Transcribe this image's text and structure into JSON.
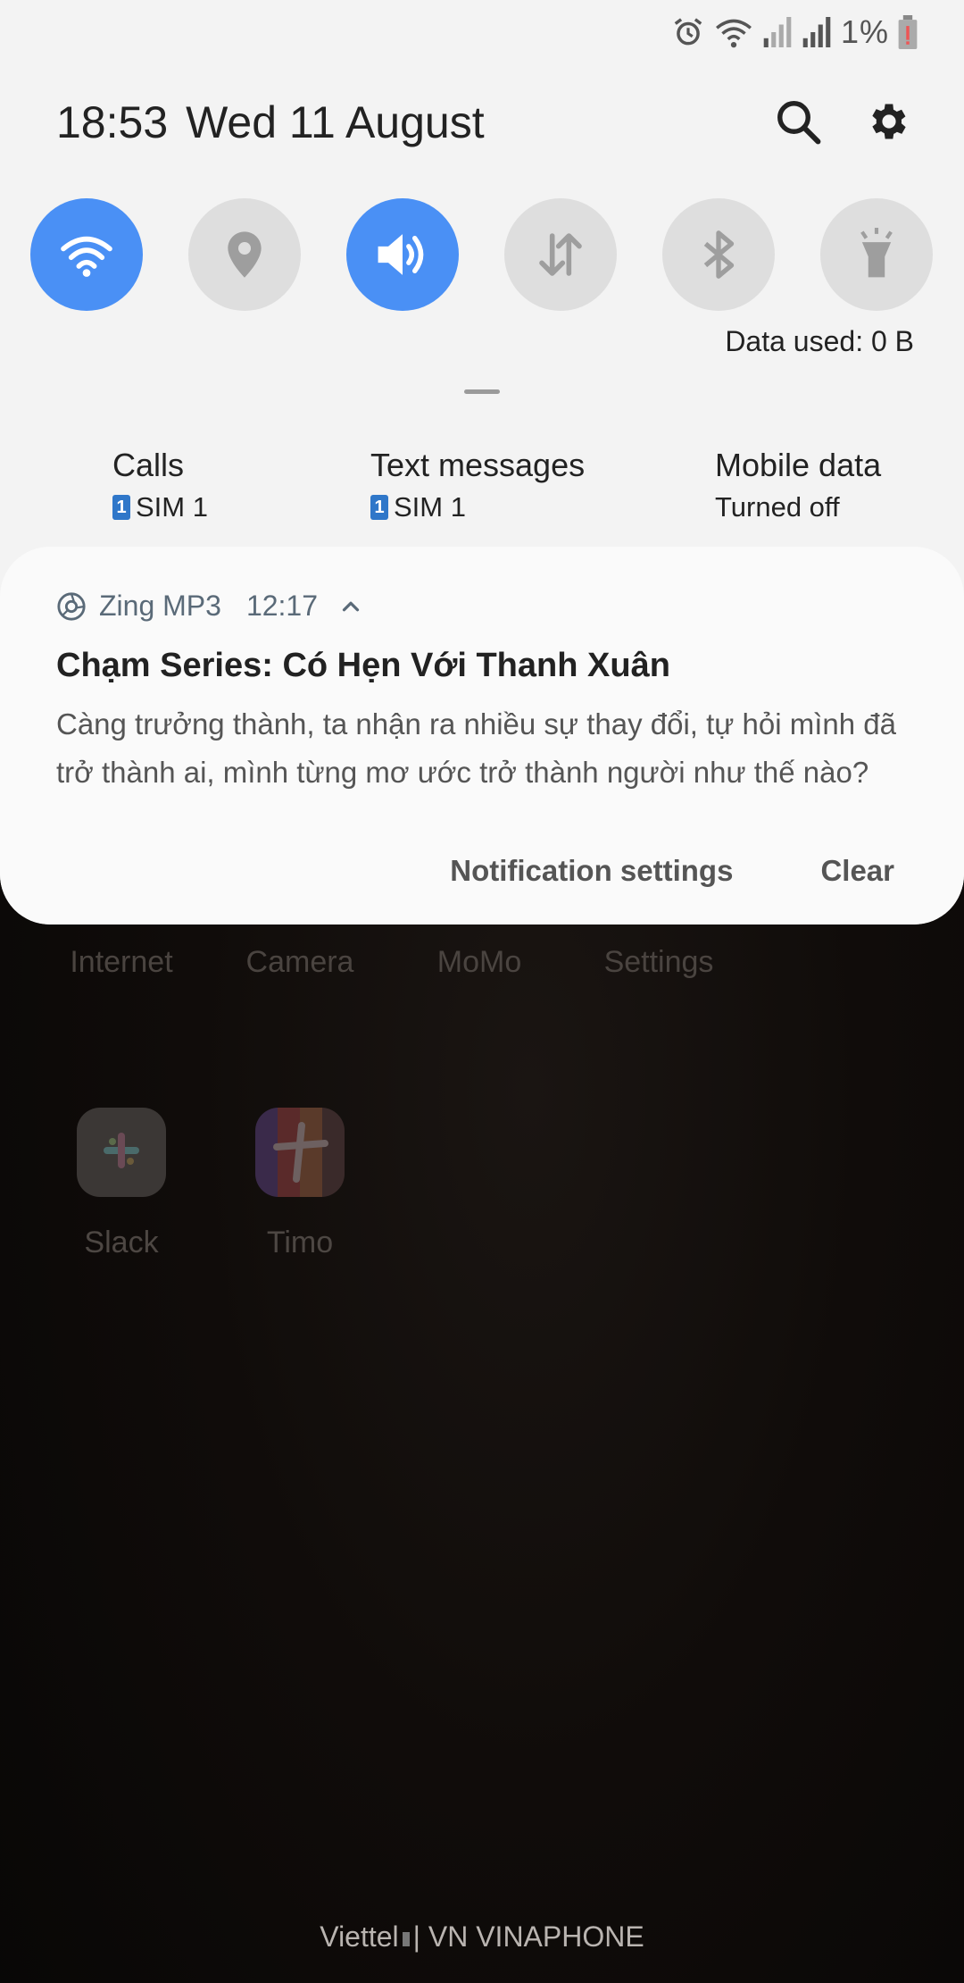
{
  "status_bar": {
    "battery_pct": "1%",
    "icons": [
      "alarm-icon",
      "wifi-icon",
      "signal-icon",
      "signal-icon",
      "battery-icon"
    ]
  },
  "header": {
    "time": "18:53",
    "date": "Wed 11 August"
  },
  "quick_settings": [
    {
      "name": "wifi",
      "state": "on"
    },
    {
      "name": "location",
      "state": "off"
    },
    {
      "name": "sound",
      "state": "on"
    },
    {
      "name": "mobile-data",
      "state": "off"
    },
    {
      "name": "bluetooth",
      "state": "off"
    },
    {
      "name": "flashlight",
      "state": "off"
    }
  ],
  "data_used": "Data used: 0 B",
  "sim_info": {
    "calls": {
      "title": "Calls",
      "sim_num": "1",
      "value": "SIM 1"
    },
    "texts": {
      "title": "Text messages",
      "sim_num": "1",
      "value": "SIM 1"
    },
    "mobile_data": {
      "title": "Mobile data",
      "value": "Turned off"
    }
  },
  "notification": {
    "app": "Zing MP3",
    "time": "12:17",
    "title": "Chạm Series: Có Hẹn Với Thanh Xuân",
    "body": "Càng trưởng thành, ta nhận ra nhiều sự thay đổi, tự hỏi mình đã trở thành ai, mình từng mơ ước trở thành người như thế nào?",
    "settings_label": "Notification settings",
    "clear_label": "Clear"
  },
  "home": {
    "dock_labels": [
      "Internet",
      "Camera",
      "MoMo",
      "Settings"
    ],
    "apps": [
      {
        "name": "Slack"
      },
      {
        "name": "Timo"
      }
    ],
    "carrier": {
      "left": "Viettel",
      "right": "VN VINAPHONE"
    }
  },
  "colors": {
    "accent": "#4a90f5",
    "shade_bg": "#f3f3f3",
    "sim_badge": "#2f77c9"
  }
}
